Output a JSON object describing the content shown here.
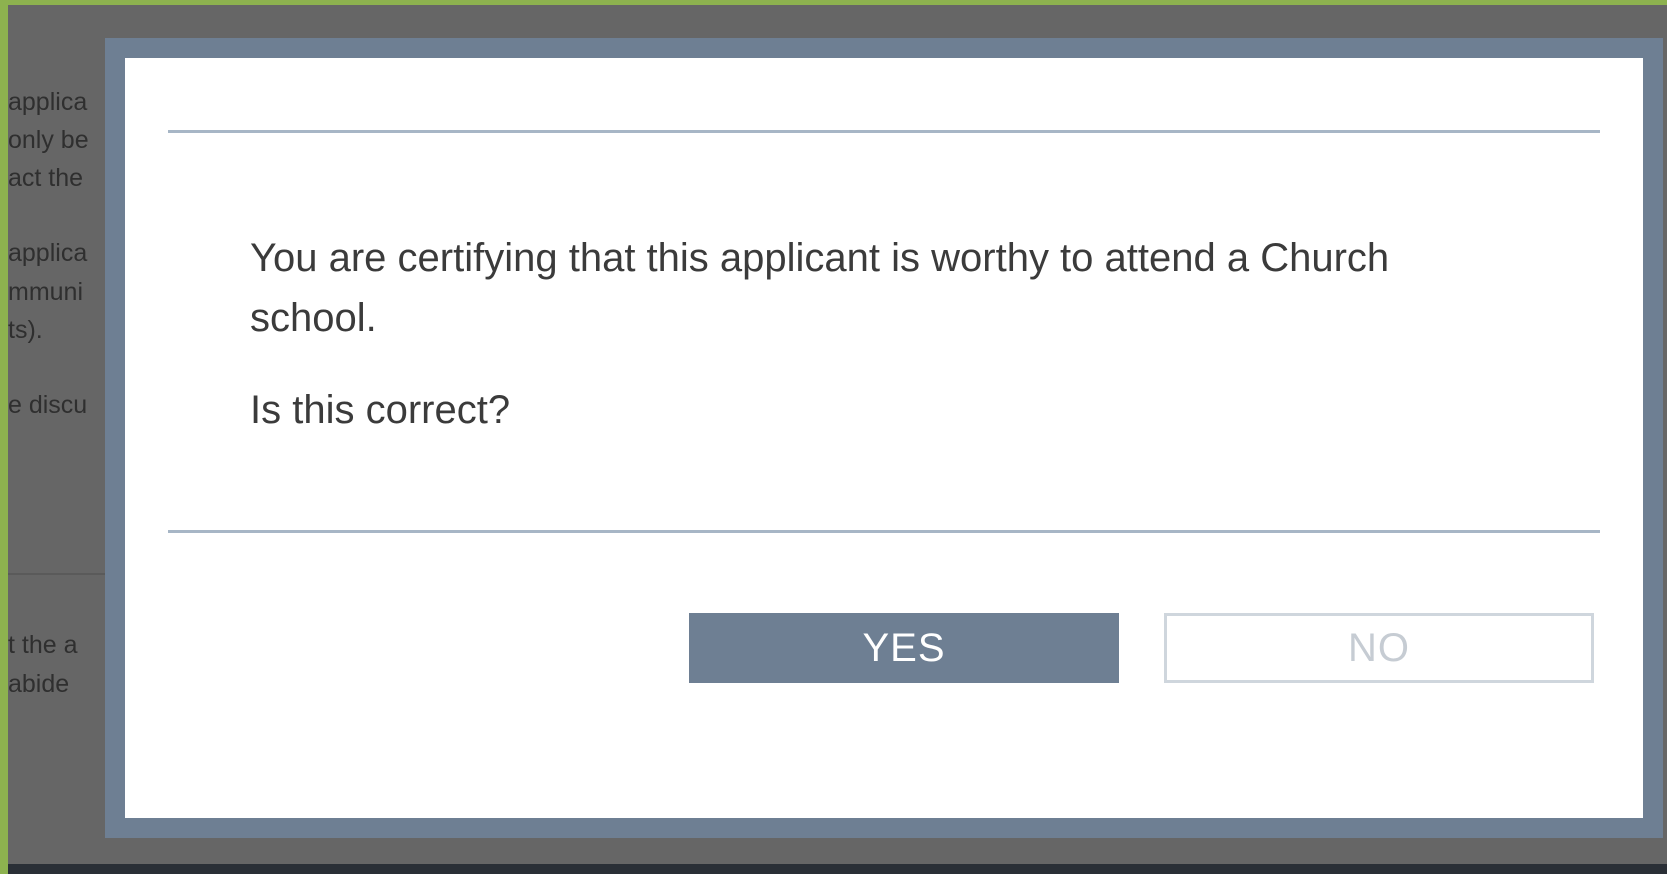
{
  "background_page": {
    "text_fragments": [
      "applica",
      "only be",
      "act the",
      "applica",
      "mmuni",
      "ts).",
      "e discu",
      "t the a",
      "abide"
    ]
  },
  "dialog": {
    "message": "You are certifying that this applicant is worthy to attend a Church school.",
    "question": "Is this correct?",
    "yes_label": "YES",
    "no_label": "NO"
  },
  "colors": {
    "outer_border": "#8db24f",
    "backdrop": "#666666",
    "modal_frame": "#6e7f93",
    "yes_button": "#6e7f93",
    "divider": "#a7b6c6"
  }
}
